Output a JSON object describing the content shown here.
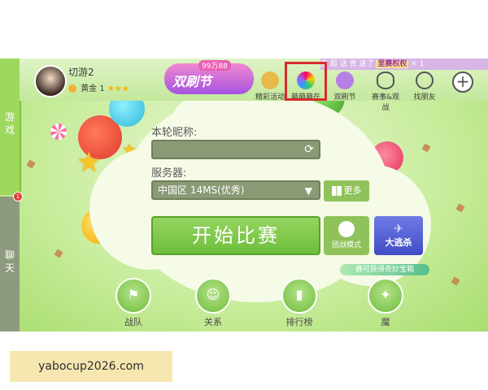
{
  "sidebar": {
    "games_tab": "游\n戏",
    "chat_tab": "聊\n天",
    "badge": "1"
  },
  "topbar": {
    "username": "切游2",
    "rank": "黄金 1",
    "stars": "★★★",
    "banner_title": "双刷节",
    "banner_tag": "99万88",
    "promo_prefix": "惠 超 活 青  送了",
    "promo_highlight": "里赛权权",
    "promo_suffix": "× 1",
    "nav": [
      {
        "label": "精彩活动"
      },
      {
        "label": "萌萌萌在"
      },
      {
        "label": "双刷节"
      },
      {
        "label": "赛事&观战"
      },
      {
        "label": "找朋友"
      }
    ],
    "plus": "+"
  },
  "form": {
    "nick_label": "本轮昵称:",
    "nick_value": "",
    "server_label": "服务器:",
    "server_value": "中国区  14MS(优秀)",
    "more_label": "更多",
    "start_label": "开始比赛",
    "team_label": "团战模式",
    "promo_label": "大逃杀",
    "chest_text": "赛可获得奇妙宝箱"
  },
  "bottom_nav": [
    {
      "label": "战队"
    },
    {
      "label": "关系"
    },
    {
      "label": "排行榜"
    },
    {
      "label": "魔"
    }
  ],
  "watermark": "yabocup2026.com",
  "colors": {
    "accent_green": "#7cc44b",
    "highlight_red": "#d92b2b",
    "promo_blue": "#3f4cc3"
  }
}
